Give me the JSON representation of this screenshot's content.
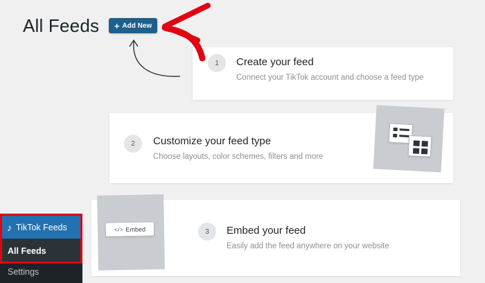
{
  "header": {
    "title": "All Feeds",
    "add_new_label": "Add New",
    "add_new_icon": "plus-icon"
  },
  "steps": [
    {
      "number": "1",
      "title": "Create your feed",
      "description": "Connect your TikTok account and choose a feed type"
    },
    {
      "number": "2",
      "title": "Customize your feed type",
      "description": "Choose layouts, color schemes, filters and more"
    },
    {
      "number": "3",
      "title": "Embed your feed",
      "description": "Easily add the feed anywhere on your website"
    }
  ],
  "illustrations": {
    "embed_label": "Embed",
    "embed_icon": "code-icon"
  },
  "sidebar": {
    "plugin_label": "TikTok Feeds",
    "plugin_icon": "tiktok-icon",
    "items": [
      {
        "label": "All Feeds",
        "active": true
      },
      {
        "label": "Settings",
        "active": false
      }
    ]
  },
  "colors": {
    "accent": "#1e5f8c",
    "highlight": "#e00512",
    "sidebar_bg": "#1d2327",
    "sidebar_active": "#2271b1"
  }
}
